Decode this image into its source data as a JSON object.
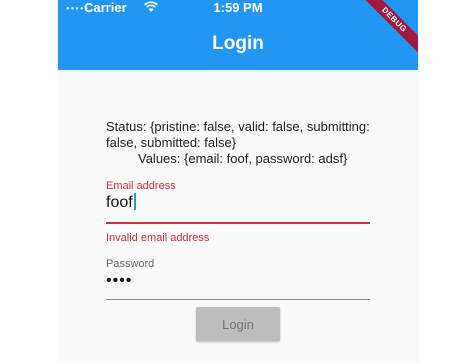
{
  "status_bar": {
    "carrier": "Carrier",
    "time": "1:59 PM",
    "wifi_icon": "wifi-icon"
  },
  "app_bar": {
    "title": "Login",
    "color": "#2196f3",
    "debug_banner": "DEBUG"
  },
  "form_state": {
    "status_line": "Status: {pristine: false, valid: false, submitting: false, submitted: false}",
    "values_line": "Values: {email: foof, password: adsf}"
  },
  "email_field": {
    "label": "Email address",
    "value": "foof",
    "error": "Invalid email address",
    "error_color": "#d32f2f"
  },
  "password_field": {
    "label": "Password",
    "masked_value": "••••"
  },
  "login_button": {
    "label": "Login",
    "disabled": true
  }
}
